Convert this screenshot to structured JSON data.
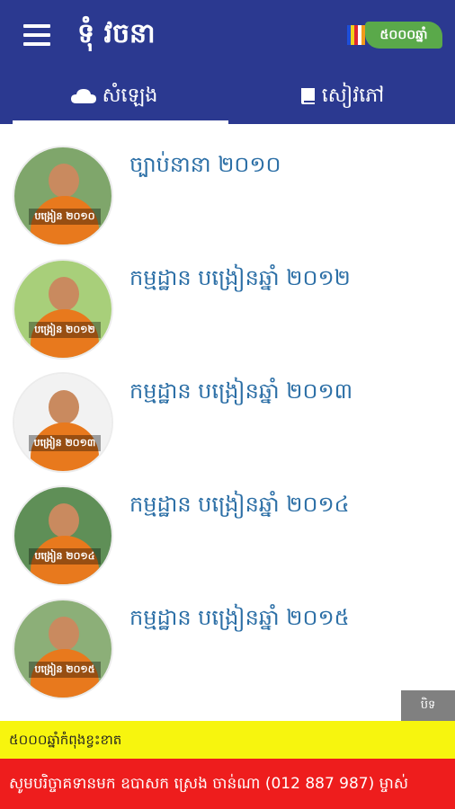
{
  "header": {
    "title": "ទុំ វចនា",
    "menu_icon": "hamburger-menu-icon",
    "brand_text": "៥០០០ឆ្នាំ"
  },
  "tabs": [
    {
      "label": "សំឡេង",
      "icon": "cloud-icon",
      "selected": true
    },
    {
      "label": "សៀវភៅ",
      "icon": "book-icon",
      "selected": false
    }
  ],
  "list": {
    "items": [
      {
        "title": "ច្បាប់នានា ២០១០",
        "thumb_label": "បង្រៀន ២០១០"
      },
      {
        "title": "កម្មដ្ឋាន បង្រៀនឆ្នាំ ២០១២",
        "thumb_label": "បង្រៀន ២០១២"
      },
      {
        "title": "កម្មដ្ឋាន បង្រៀនឆ្នាំ ២០១៣",
        "thumb_label": "បង្រៀន ២០១៣"
      },
      {
        "title": "កម្មដ្ឋាន បង្រៀនឆ្នាំ ២០១៤",
        "thumb_label": "បង្រៀន ២០១៤"
      },
      {
        "title": "កម្មដ្ឋាន បង្រៀនឆ្នាំ ២០១៥",
        "thumb_label": "បង្រៀន ២០១៥"
      }
    ]
  },
  "ad": {
    "close_label": "បិទ",
    "yellow_text": "៥០០០ឆ្នាំកំពុងខ្វះខាត",
    "red_text": "សូមបរិច្ចាគទានមក ឧបាសក ស្រេង ចាន់ណា (012 887 987) ម្ចាស់"
  },
  "colors": {
    "appbar": "#2b3990",
    "title_text": "#2c6fa6",
    "banner_yellow": "#f7f50e",
    "banner_red": "#ee1d1d",
    "brand_green": "#5aa94a"
  }
}
